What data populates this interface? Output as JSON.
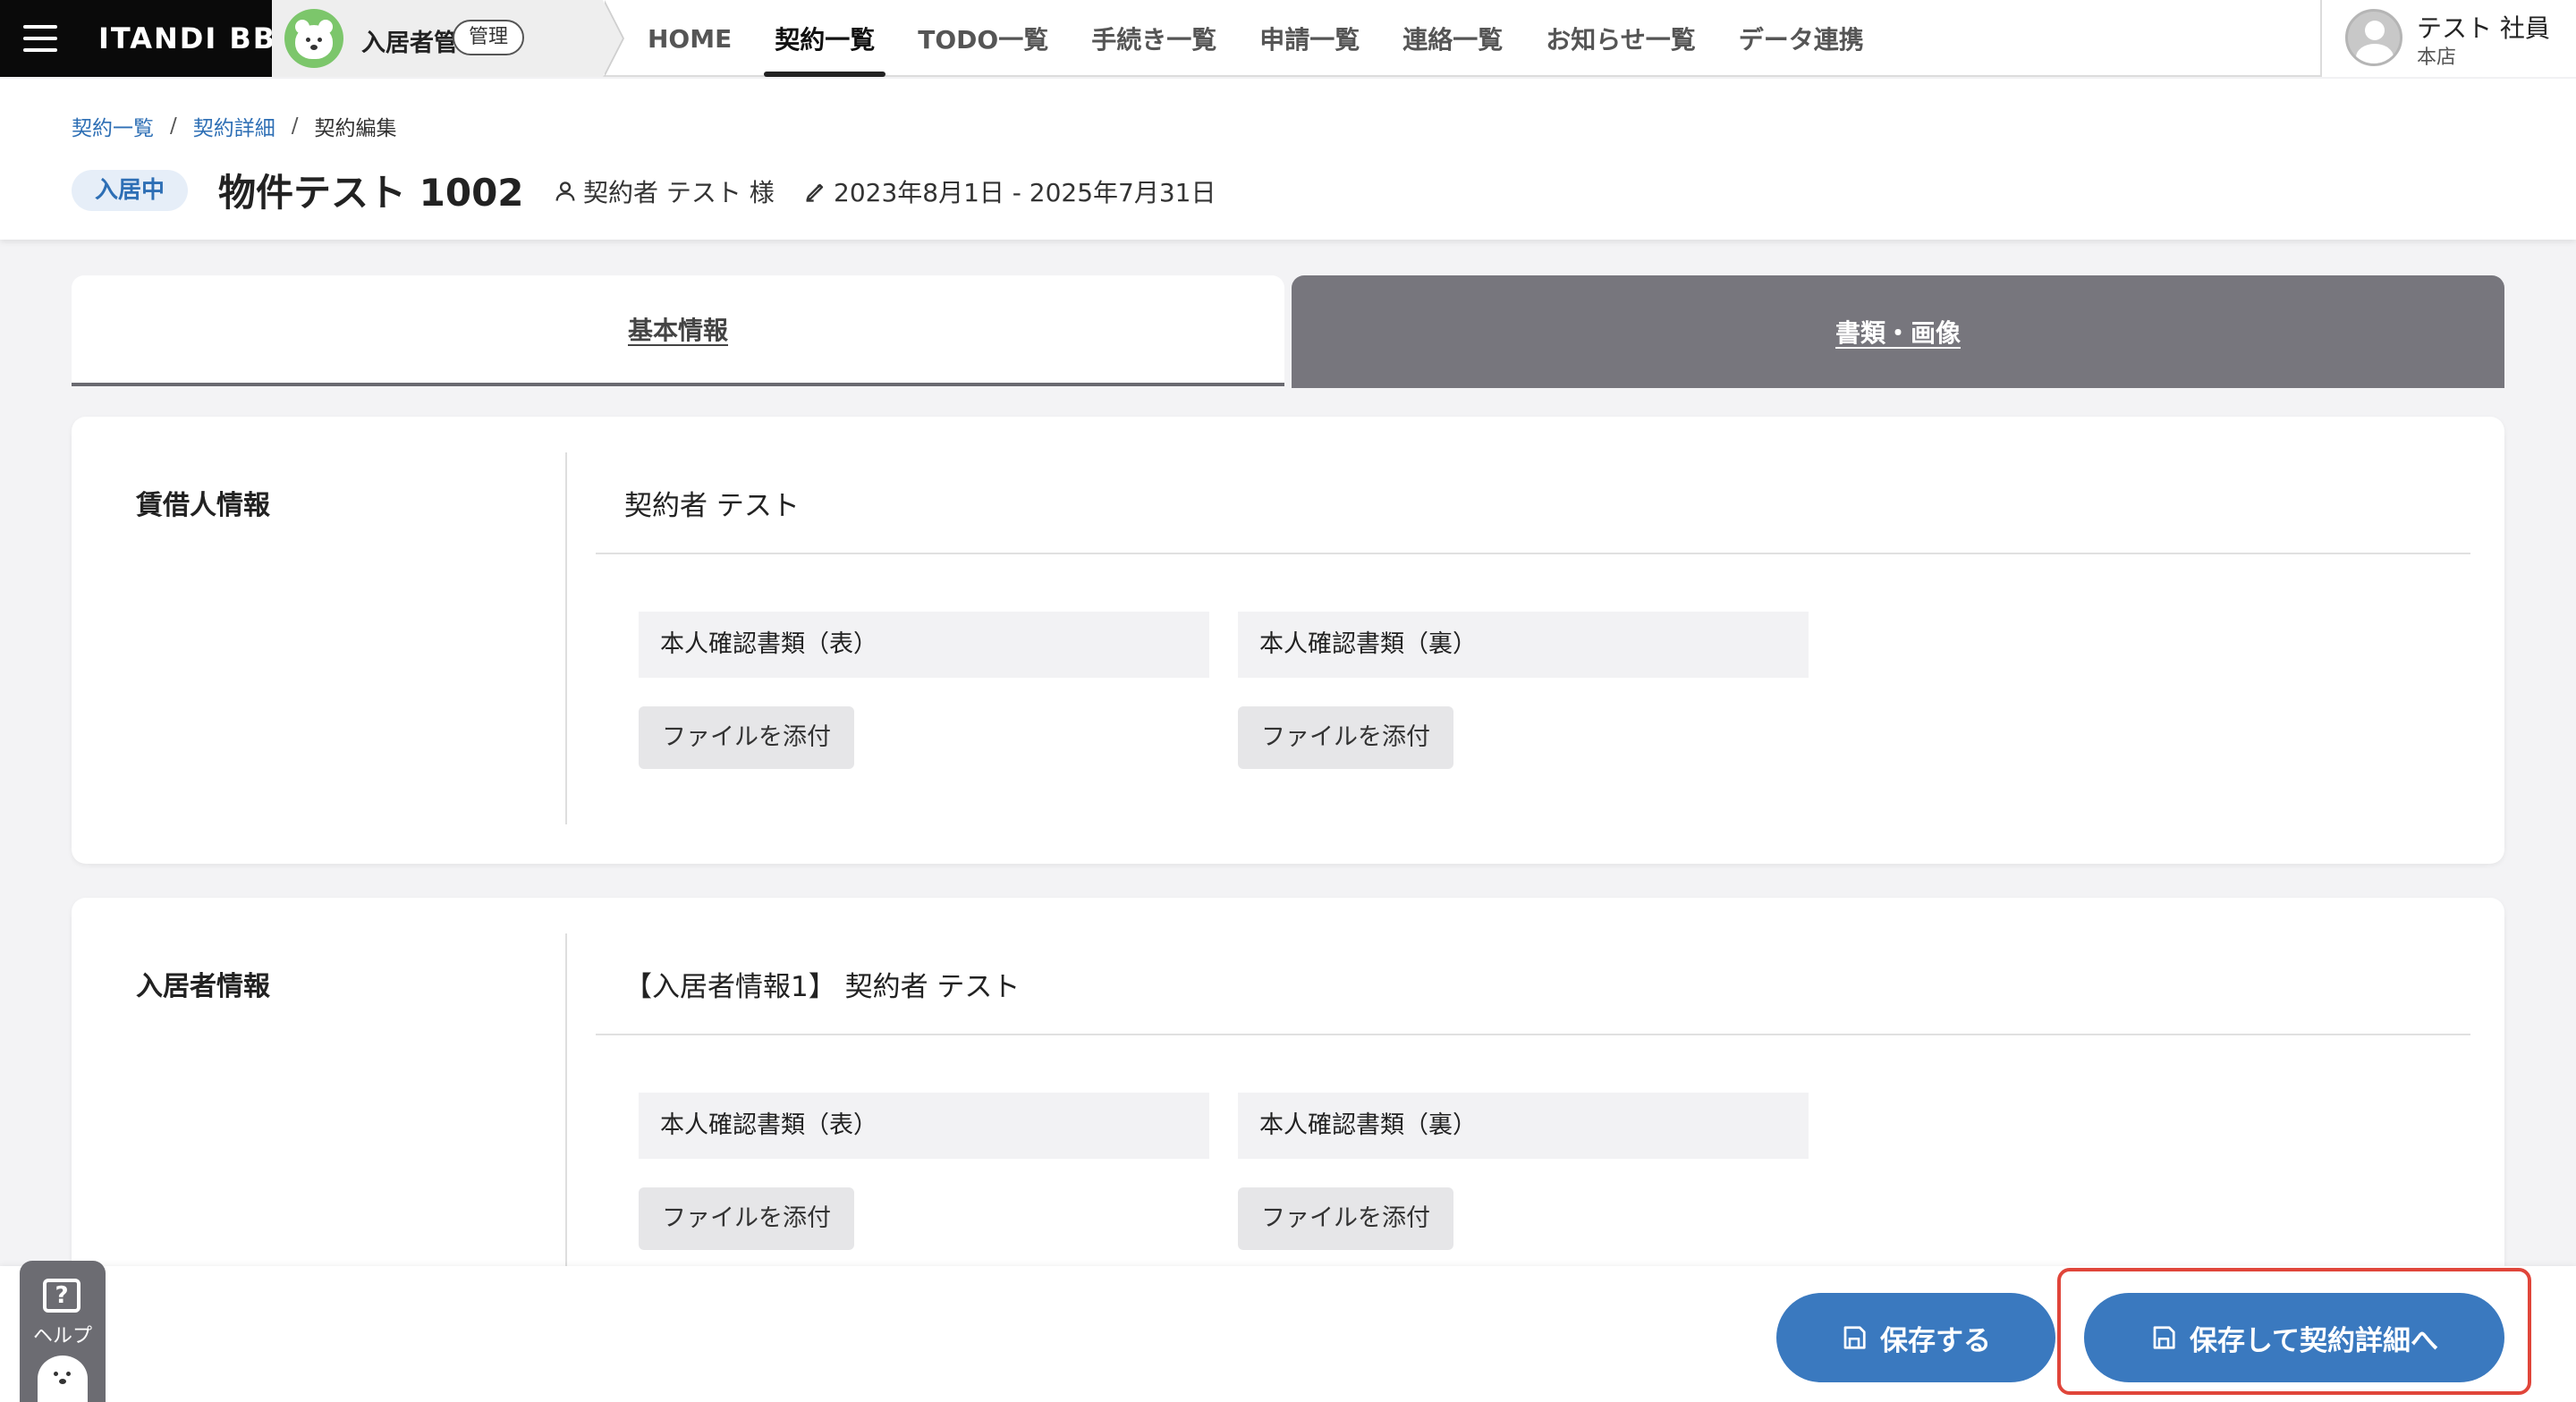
{
  "header": {
    "brand": "ITANDI BB",
    "app_name": "入居者管理",
    "app_badge": "管理",
    "nav": [
      {
        "label": "HOME"
      },
      {
        "label": "契約一覧"
      },
      {
        "label": "TODO一覧"
      },
      {
        "label": "手続き一覧"
      },
      {
        "label": "申請一覧"
      },
      {
        "label": "連絡一覧"
      },
      {
        "label": "お知らせ一覧"
      },
      {
        "label": "データ連携"
      }
    ],
    "active_nav": "契約一覧",
    "user": {
      "name": "テスト 社員",
      "branch": "本店"
    }
  },
  "breadcrumb": {
    "items": [
      "契約一覧",
      "契約詳細"
    ],
    "separator": "/",
    "current": "契約編集"
  },
  "contract": {
    "status": "入居中",
    "property": "物件テスト 1002",
    "contractor": "契約者 テスト 様",
    "period": "2023年8月1日 - 2025年7月31日"
  },
  "tabs": [
    {
      "label": "基本情報"
    },
    {
      "label": "書類・画像"
    }
  ],
  "active_tab": "書類・画像",
  "sections": [
    {
      "title": "賃借人情報",
      "person": "契約者 テスト",
      "documents": [
        {
          "label": "本人確認書類（表）",
          "button": "ファイルを添付"
        },
        {
          "label": "本人確認書類（裏）",
          "button": "ファイルを添付"
        }
      ]
    },
    {
      "title": "入居者情報",
      "person": "【入居者情報1】 契約者 テスト",
      "documents": [
        {
          "label": "本人確認書類（表）",
          "button": "ファイルを添付"
        },
        {
          "label": "本人確認書類（裏）",
          "button": "ファイルを添付"
        }
      ]
    }
  ],
  "footer": {
    "save": "保存する",
    "save_and_detail": "保存して契約詳細へ"
  },
  "help": {
    "label": "ヘルプ",
    "icon_glyph": "?"
  },
  "icons": {
    "menu": "hamburger-icon",
    "person": "person-icon",
    "pen": "pen-icon",
    "save": "floppy-disk-icon"
  },
  "colors": {
    "accent": "#3a79bf",
    "link": "#2e6fb5",
    "active_tab_bg": "#77767d",
    "highlight": "#e0453a",
    "status_chip_bg": "#e6eef8"
  }
}
